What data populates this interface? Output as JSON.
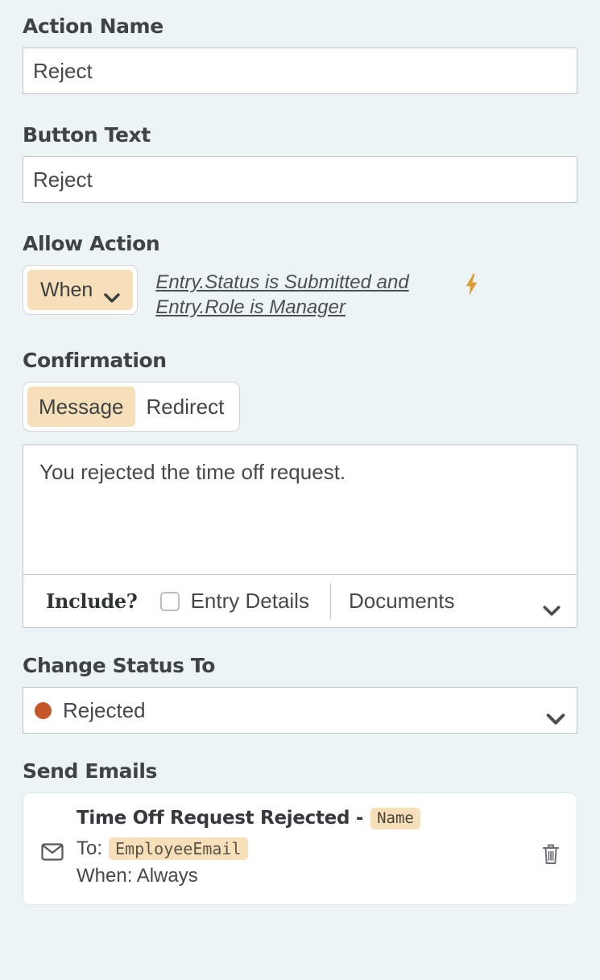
{
  "theme": {
    "page_background": "#edf4f5",
    "accent_tan": "#f7e0b9",
    "bolt_color": "#dd9b33",
    "status_dot_color": "#c4562a",
    "text_color": "#3a3f41",
    "input_border": "#c2c5c6"
  },
  "sections": {
    "action_name": {
      "label": "Action Name",
      "value": "Reject"
    },
    "button_text": {
      "label": "Button Text",
      "value": "Reject"
    },
    "allow_action": {
      "label": "Allow Action",
      "mode": "When",
      "condition": "Entry.Status is Submitted and Entry.Role is Manager",
      "bolt_icon": "lightning-bolt-icon",
      "chevron_icon": "chevron-down-icon"
    },
    "confirmation": {
      "label": "Confirmation",
      "tabs": [
        {
          "label": "Message",
          "selected": true
        },
        {
          "label": "Redirect",
          "selected": false
        }
      ],
      "message": "You rejected the time off request.",
      "include": {
        "label": "Include?",
        "entry_details_label": "Entry Details",
        "entry_details_checked": false,
        "documents_label": "Documents",
        "documents_chevron_icon": "chevron-down-icon"
      }
    },
    "change_status": {
      "label": "Change Status To",
      "value": "Rejected",
      "dot_color": "#c4562a",
      "chevron_icon": "chevron-down-icon"
    },
    "send_emails": {
      "label": "Send Emails",
      "emails": [
        {
          "subject_text": "Time Off Request Rejected - ",
          "subject_token": "Name",
          "to_label": "To:",
          "to_token": "EmployeeEmail",
          "when_text": "When: Always",
          "envelope_icon": "envelope-icon",
          "delete_icon": "trash-icon"
        }
      ]
    }
  }
}
